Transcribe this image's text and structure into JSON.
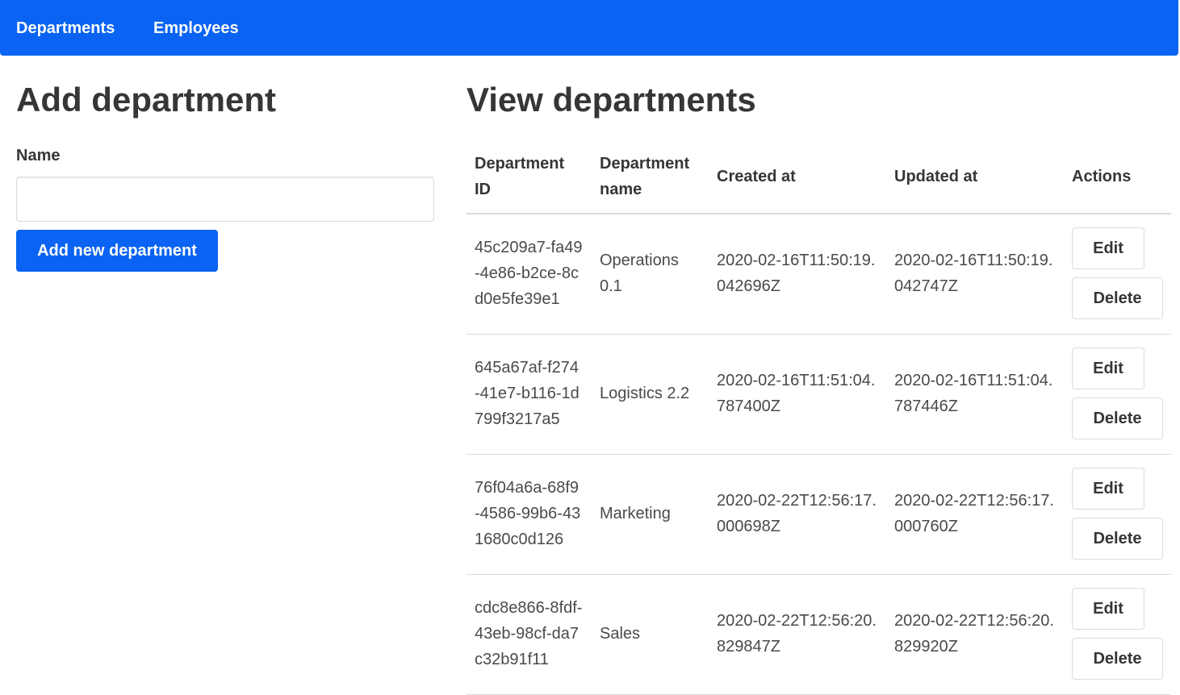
{
  "nav": {
    "departments": "Departments",
    "employees": "Employees"
  },
  "add_form": {
    "title": "Add department",
    "name_label": "Name",
    "name_value": "",
    "submit_label": "Add new department"
  },
  "view": {
    "title": "View departments",
    "columns": [
      "Department ID",
      "Department name",
      "Created at",
      "Updated at",
      "Actions"
    ],
    "edit_label": "Edit",
    "delete_label": "Delete",
    "rows": [
      {
        "id": "45c209a7-fa49-4e86-b2ce-8cd0e5fe39e1",
        "name": "Operations 0.1",
        "created": "2020-02-16T11:50:19.042696Z",
        "updated": "2020-02-16T11:50:19.042747Z"
      },
      {
        "id": "645a67af-f274-41e7-b116-1d799f3217a5",
        "name": "Logistics 2.2",
        "created": "2020-02-16T11:51:04.787400Z",
        "updated": "2020-02-16T11:51:04.787446Z"
      },
      {
        "id": "76f04a6a-68f9-4586-99b6-431680c0d126",
        "name": "Marketing",
        "created": "2020-02-22T12:56:17.000698Z",
        "updated": "2020-02-22T12:56:17.000760Z"
      },
      {
        "id": "cdc8e866-8fdf-43eb-98cf-da7c32b91f11",
        "name": "Sales",
        "created": "2020-02-22T12:56:20.829847Z",
        "updated": "2020-02-22T12:56:20.829920Z"
      }
    ]
  },
  "colors": {
    "brand": "#0a63f2",
    "text": "#363636",
    "border": "#dbdbdb"
  }
}
